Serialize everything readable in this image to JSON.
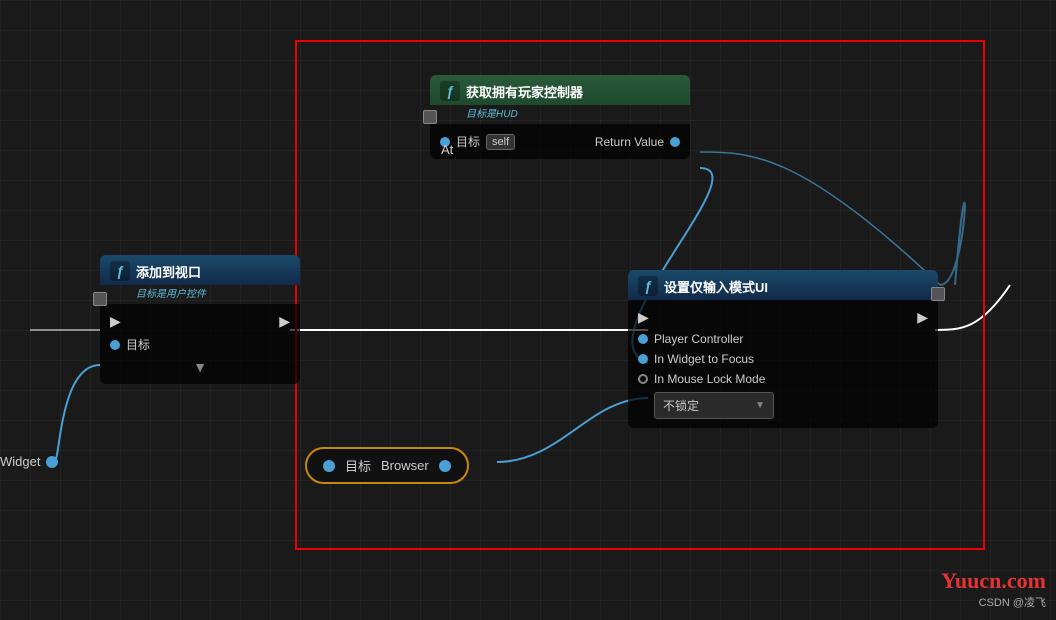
{
  "canvas": {
    "bg_color": "#1a1a1a",
    "grid_color": "rgba(255,255,255,0.04)"
  },
  "nodes": {
    "get_controller": {
      "title": "获取拥有玩家控制器",
      "subtitle": "目标是HUD",
      "target_label": "目标",
      "target_value": "self",
      "return_label": "Return Value",
      "at_label": "At"
    },
    "add_viewport": {
      "title": "添加到视口",
      "subtitle": "目标是用户控件",
      "target_label": "目标"
    },
    "set_input": {
      "title": "设置仅输入模式UI",
      "player_controller_label": "Player Controller",
      "in_widget_label": "In Widget to Focus",
      "mouse_lock_label": "In Mouse Lock Mode",
      "dropdown_value": "不锁定"
    },
    "browser_node": {
      "target_label": "目标",
      "value_label": "Browser"
    },
    "widget_node": {
      "label": "Widget"
    }
  },
  "watermark": {
    "site": "Yuucn.com",
    "author": "CSDN @凌飞"
  }
}
